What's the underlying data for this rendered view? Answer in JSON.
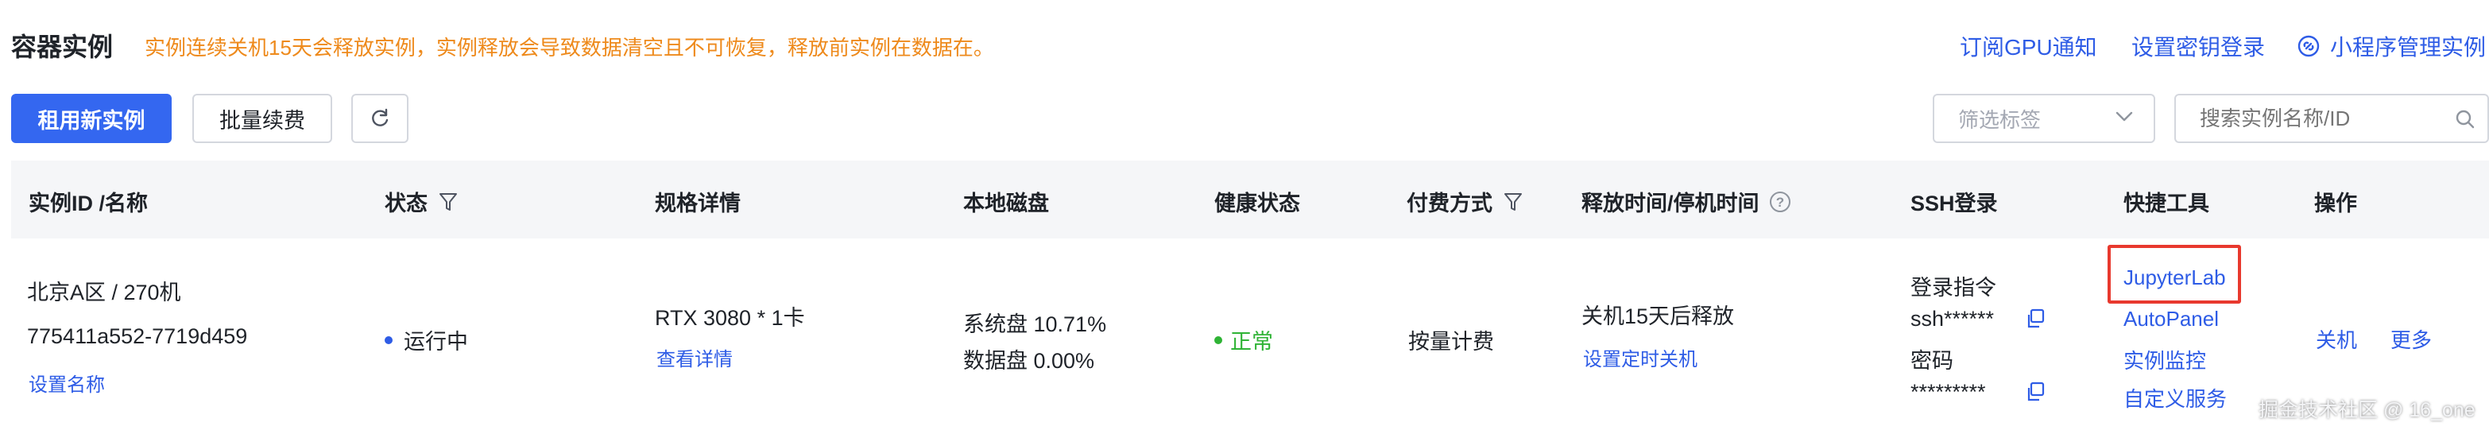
{
  "page": {
    "title": "容器实例",
    "warning": "实例连续关机15天会释放实例，实例释放会导致数据清空且不可恢复，释放前实例在数据在。",
    "header_links": {
      "gpu_notify": "订阅GPU通知",
      "set_key_login": "设置密钥登录",
      "mini_program": "小程序管理实例"
    },
    "colors": {
      "primary": "#3467f0",
      "link": "#2e5ce6",
      "warning": "#ee8a1c",
      "success": "#2fb335",
      "highlight": "#e8392e"
    }
  },
  "toolbar": {
    "rent_new": "租用新实例",
    "batch_renew": "批量续费",
    "refresh_icon": "refresh-icon",
    "tag_filter_placeholder": "筛选标签",
    "search_placeholder": "搜索实例名称/ID"
  },
  "table": {
    "columns": {
      "id_name": "实例ID /名称",
      "status": "状态",
      "spec": "规格详情",
      "disk": "本地磁盘",
      "health": "健康状态",
      "billing": "付费方式",
      "release_time": "释放时间/停机时间",
      "ssh": "SSH登录",
      "tools": "快捷工具",
      "actions": "操作"
    },
    "row": {
      "name": "北京A区 / 270机",
      "id": "775411a552-7719d459",
      "set_name": "设置名称",
      "status": "运行中",
      "spec": "RTX 3080 * 1卡",
      "view_details": "查看详情",
      "system_disk": "系统盘 10.71%",
      "data_disk": "数据盘 0.00%",
      "health": "正常",
      "billing": "按量计费",
      "release": "关机15天后释放",
      "set_timer": "设置定时关机",
      "login_cmd_label": "登录指令",
      "login_cmd": "ssh******",
      "password_label": "密码",
      "password": "*********",
      "tools": {
        "jupyterlab": "JupyterLab",
        "autopanel": "AutoPanel",
        "monitor": "实例监控",
        "custom": "自定义服务"
      },
      "actions": {
        "shutdown": "关机",
        "more": "更多"
      }
    }
  },
  "watermark": "掘金技术社区 @ 16_one"
}
